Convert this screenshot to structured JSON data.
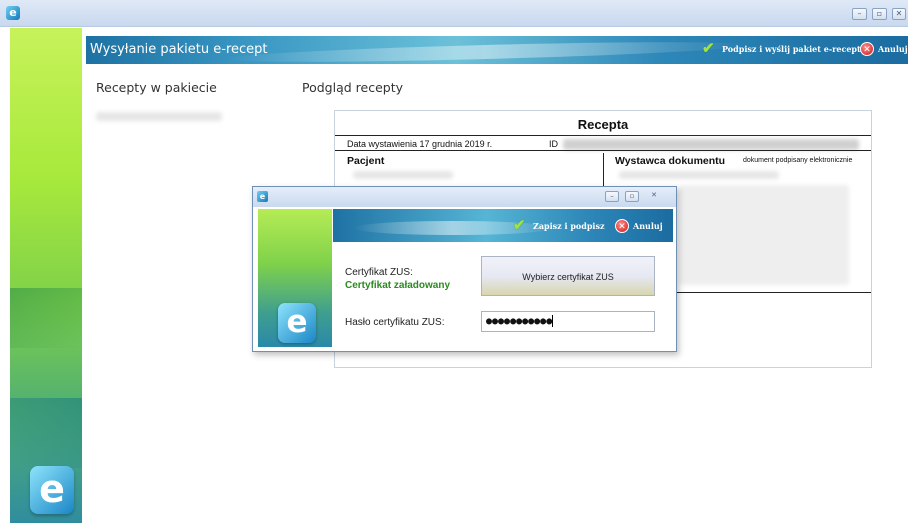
{
  "window": {
    "app_icon": "e-icon",
    "controls": [
      "minimize",
      "maximize",
      "close"
    ]
  },
  "header": {
    "title": "Wysyłanie pakietu e-recept",
    "sign_send_label": "Podpisz i wyślij pakiet e-recept",
    "cancel_label": "Anuluj"
  },
  "left_panel": {
    "heading": "Recepty w pakiecie"
  },
  "preview": {
    "heading": "Podgląd recepty",
    "title": "Recepta",
    "issue_date_label": "Data wystawienia",
    "issue_date": "17 grudnia 2019 r.",
    "id_label": "ID",
    "patient_label": "Pacjent",
    "issuer_label": "Wystawca dokumentu",
    "signed_note": "dokument podpisany elektronicznie"
  },
  "dialog": {
    "controls": [
      "minimize",
      "maximize",
      "close"
    ],
    "save_sign_label": "Zapisz i podpisz",
    "cancel_label": "Anuluj",
    "cert_label": "Certyfikat ZUS:",
    "cert_status": "Certyfikat załadowany",
    "choose_cert_label": "Wybierz certyfikat ZUS",
    "password_label": "Hasło certyfikatu ZUS:",
    "password_value": "●●●●●●●●●●●"
  },
  "colors": {
    "header_blue": "#1e72a3",
    "sidebar_green": "#a8e93c",
    "status_green": "#2b8a1f",
    "cancel_red": "#d01818"
  }
}
